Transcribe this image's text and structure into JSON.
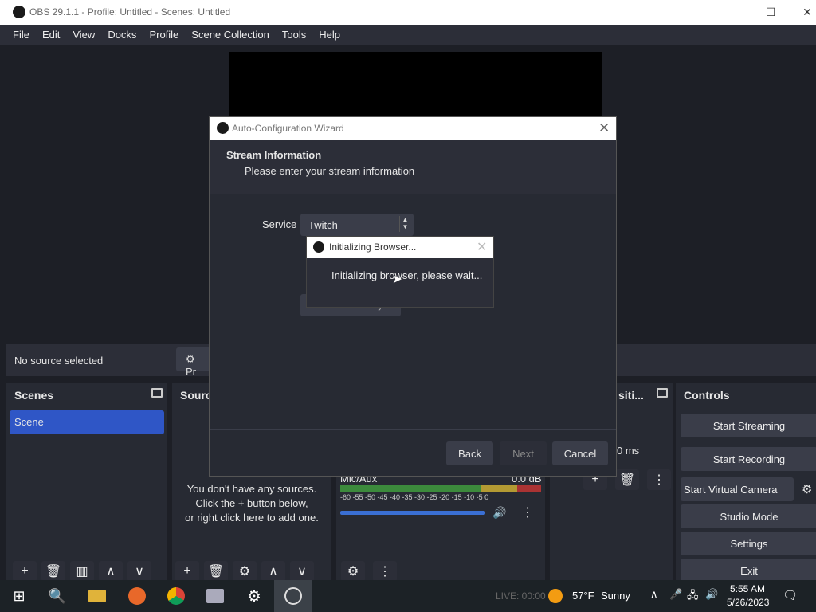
{
  "window": {
    "title": "OBS 29.1.1 - Profile: Untitled - Scenes: Untitled",
    "minimize": "—",
    "maximize": "☐",
    "close": "✕"
  },
  "menu": [
    "File",
    "Edit",
    "View",
    "Docks",
    "Profile",
    "Scene Collection",
    "Tools",
    "Help"
  ],
  "source_bar": {
    "no_source": "No source selected",
    "properties": "Pr"
  },
  "scenes": {
    "title": "Scenes",
    "items": [
      "Scene"
    ]
  },
  "sources": {
    "title": "Sourc",
    "empty_1": "You don't have any sources.",
    "empty_2": "Click the + button below,",
    "empty_3": "or right click here to add one."
  },
  "audio": {
    "channel": "Mic/Aux",
    "level": "0.0 dB",
    "ticks": "-60 -55 -50 -45 -40 -35 -30 -25 -20 -15 -10 -5 0",
    "volume_pct": 100
  },
  "transitions": {
    "title": "siti...",
    "duration": "0 ms"
  },
  "controls": {
    "title": "Controls",
    "start_streaming": "Start Streaming",
    "start_recording": "Start Recording",
    "start_virtual_camera": "Start Virtual Camera",
    "studio_mode": "Studio Mode",
    "settings": "Settings",
    "exit": "Exit"
  },
  "wizard": {
    "title": "Auto-Configuration Wizard",
    "heading": "Stream Information",
    "subheading": "Please enter your stream information",
    "service_label": "Service",
    "service_value": "Twitch",
    "stream_key_button": "Use Stream Key",
    "back": "Back",
    "next": "Next",
    "cancel": "Cancel"
  },
  "init_dialog": {
    "title": "Initializing Browser...",
    "message": "Initializing browser, please wait..."
  },
  "taskbar": {
    "live": "LIVE: 00:00",
    "weather_temp": "57°F",
    "weather_desc": "Sunny",
    "time": "5:55 AM",
    "date": "5/26/2023"
  },
  "colors": {
    "accent": "#2f56c6",
    "panel": "#272a33",
    "background": "#1d1f26"
  }
}
